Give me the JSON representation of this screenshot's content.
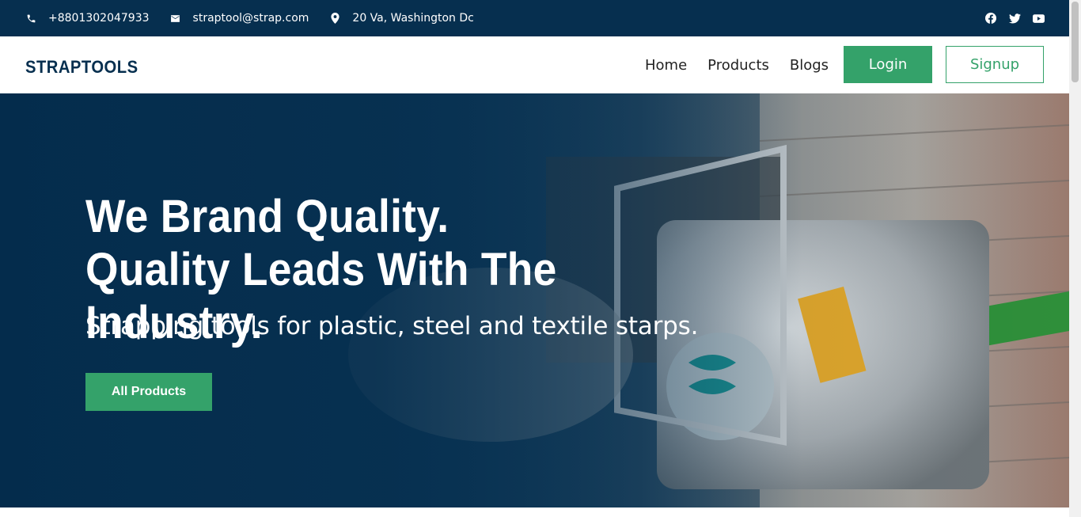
{
  "topbar": {
    "phone": "+8801302047933",
    "email": "straptool@strap.com",
    "address": "20 Va, Washington Dc",
    "icons": {
      "phone": "phone-icon",
      "email": "mail-icon",
      "address": "location-pin-icon"
    },
    "social": [
      "facebook-icon",
      "twitter-icon",
      "youtube-icon"
    ]
  },
  "nav": {
    "brand": "STRAPTOOLS",
    "links": [
      "Home",
      "Products",
      "Blogs"
    ],
    "login": "Login",
    "signup": "Signup"
  },
  "hero": {
    "title": "We Brand Quality. Quality Leads With The Industry.",
    "subtitle": "Strapping tools for plastic, steel and textile starps.",
    "cta": "All Products"
  },
  "colors": {
    "navy": "#062f4f",
    "accent_green": "#34a26a",
    "white": "#ffffff"
  }
}
